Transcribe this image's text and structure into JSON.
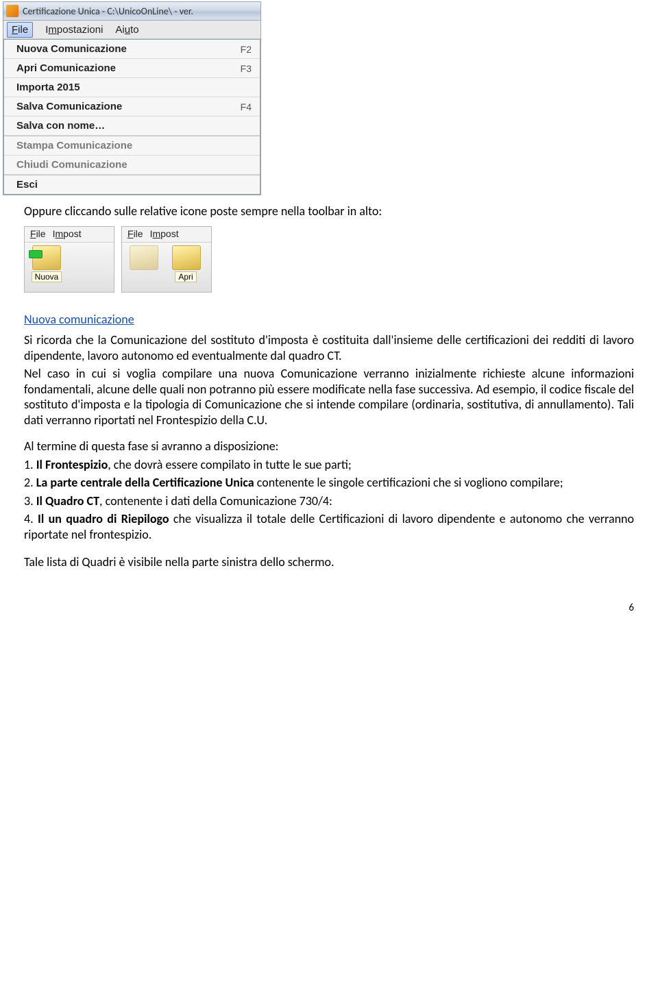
{
  "screenshot1": {
    "title": "Certificazione Unica - C:\\UnicoOnLine\\  -  ver.",
    "menubar": {
      "file": "File",
      "impostazioni": "Impostazioni",
      "aiuto": "Aiuto"
    },
    "items": [
      {
        "label": "Nuova Comunicazione",
        "shortcut": "F2",
        "enabled": true
      },
      {
        "label": "Apri Comunicazione",
        "shortcut": "F3",
        "enabled": true
      },
      {
        "label": "Importa 2015",
        "shortcut": "",
        "enabled": true
      },
      {
        "label": "Salva Comunicazione",
        "shortcut": "F4",
        "enabled": true
      },
      {
        "label": "Salva con nome…",
        "shortcut": "",
        "enabled": true
      },
      {
        "label": "Stampa Comunicazione",
        "shortcut": "",
        "enabled": false
      },
      {
        "label": "Chiudi Comunicazione",
        "shortcut": "",
        "enabled": false
      },
      {
        "label": "Esci",
        "shortcut": "",
        "enabled": true
      }
    ]
  },
  "intro_line": "Oppure cliccando sulle relative icone poste sempre nella toolbar in alto:",
  "screenshot2": {
    "menu": {
      "file": "File",
      "impost": "Impost"
    },
    "btn_nuova": "Nuova",
    "btn_apri": "Apri"
  },
  "section_heading": "Nuova comunicazione",
  "para1": "Si ricorda che la Comunicazione del sostituto d'imposta è costituita dall'insieme delle certificazioni dei redditi di lavoro dipendente, lavoro autonomo ed eventualmente dal quadro CT.",
  "para2": "Nel caso in cui si voglia compilare una nuova Comunicazione verranno inizialmente richieste alcune informazioni fondamentali, alcune delle quali non potranno più essere modificate nella fase successiva. Ad esempio, il codice fiscale del sostituto d'imposta e la tipologia di Comunicazione che si intende compilare (ordinaria, sostitutiva, di annullamento). Tali dati verranno riportati nel Frontespizio della C.U.",
  "para3": "Al termine di questa fase si avranno a disposizione:",
  "list": {
    "n1_prefix": "1. ",
    "n1_bold": "Il Frontespizio",
    "n1_rest": ", che dovrà essere compilato in tutte le sue parti;",
    "n2_prefix": "2. ",
    "n2_bold": "La parte centrale della Certificazione Unica",
    "n2_rest": " contenente le singole certificazioni che si vogliono compilare;",
    "n3_prefix": "3. ",
    "n3_bold": "Il Quadro CT",
    "n3_rest": ", contenente i dati della Comunicazione 730/4:",
    "n4_prefix": "4. ",
    "n4_bold": "Il un quadro di Riepilogo",
    "n4_rest": " che visualizza il totale delle Certificazioni di lavoro dipendente e autonomo che verranno riportate nel frontespizio."
  },
  "closing": "Tale lista di Quadri è visibile nella parte sinistra dello schermo.",
  "page_number": "6"
}
